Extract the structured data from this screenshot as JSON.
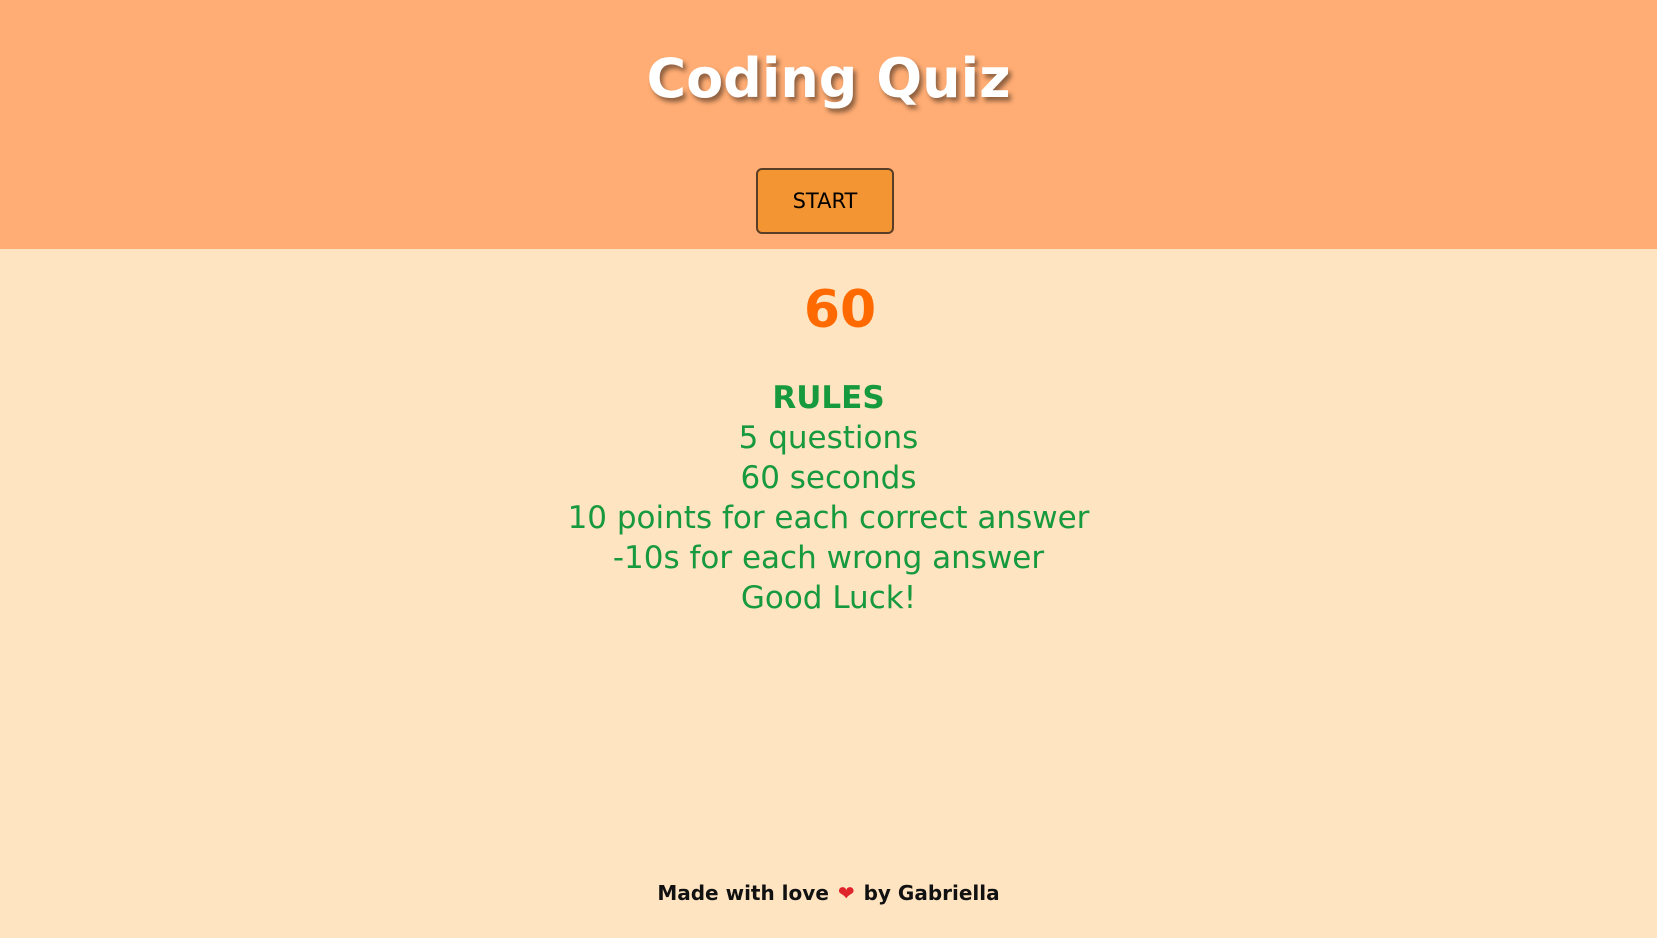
{
  "header": {
    "title": "Coding Quiz",
    "start_label": "START",
    "background": "#ffad74"
  },
  "timer": {
    "value": "60",
    "color": "#ff6a00"
  },
  "rules": {
    "heading": "RULES",
    "lines": [
      "5 questions",
      "60 seconds",
      "10 points for each correct answer",
      "-10s for each wrong answer",
      "Good Luck!"
    ],
    "color": "#169a3d"
  },
  "footer": {
    "prefix": "Made with love",
    "heart_icon": "heart-icon",
    "heart_glyph": "❤",
    "suffix": "by Gabriella"
  },
  "colors": {
    "page_background": "#ffe4c2",
    "button_background": "#f39532"
  }
}
